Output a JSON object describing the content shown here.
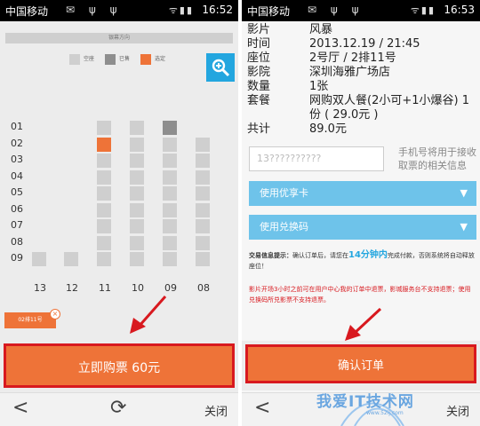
{
  "status_left": {
    "carrier": "中国移动",
    "time": "16:52"
  },
  "status_right": {
    "carrier": "中国移动",
    "time": "16:53"
  },
  "seatmap": {
    "screen_label": "银幕方向",
    "legend": [
      {
        "label": "空座",
        "color": "#cfcfcf"
      },
      {
        "label": "已售",
        "color": "#8e8e8e"
      },
      {
        "label": "选定",
        "color": "#ee7338"
      }
    ],
    "zoom_icon": "zoom-in-icon",
    "rows": [
      "01",
      "02",
      "03",
      "04",
      "05",
      "06",
      "07",
      "08",
      "09"
    ],
    "columns": [
      "13",
      "12",
      "11",
      "10",
      "09",
      "08"
    ],
    "sold_seats": [
      {
        "row": "01",
        "col": "09"
      }
    ],
    "selected_seats": [
      {
        "row": "02",
        "col": "11"
      }
    ],
    "selected_tag": "02排11号",
    "tag_close": "×",
    "buy_button": "立即购票 60元"
  },
  "nav_left": {
    "back": "<",
    "refresh": "⟳",
    "close": "关闭"
  },
  "order": {
    "rows": [
      {
        "key": "影片",
        "value": "风暴"
      },
      {
        "key": "时间",
        "value": "2013.12.19 / 21:45"
      },
      {
        "key": "座位",
        "value": "2号厅 / 2排11号"
      },
      {
        "key": "影院",
        "value": "深圳海雅广场店"
      },
      {
        "key": "数量",
        "value": "1张"
      },
      {
        "key": "套餐",
        "value": "网购双人餐(2小可+1小爆谷) 1份 ( 29.0元 )"
      },
      {
        "key": "共计",
        "value": "89.0元"
      }
    ],
    "phone_value": "13??????????",
    "phone_note": "手机号将用于接收取票的相关信息",
    "coupon_button": "使用优享卡",
    "redeem_button": "使用兑换码",
    "tips_title": "交易信息提示：",
    "tips_before": "确认订单后，请您在",
    "tips_highlight": "14分钟内",
    "tips_after": "完成付款，否则系统将自动释放座位！",
    "warning": "影片开场3小时之前可在用户中心我的订单中退票，影城服务台不支持退票；使用兑换码所兑影票不支持退票。",
    "confirm_button": "确认订单"
  },
  "nav_right": {
    "back": "<",
    "close": "关闭"
  },
  "watermark": {
    "text": "我爱IT技术网",
    "url": "www.52ij.com"
  }
}
